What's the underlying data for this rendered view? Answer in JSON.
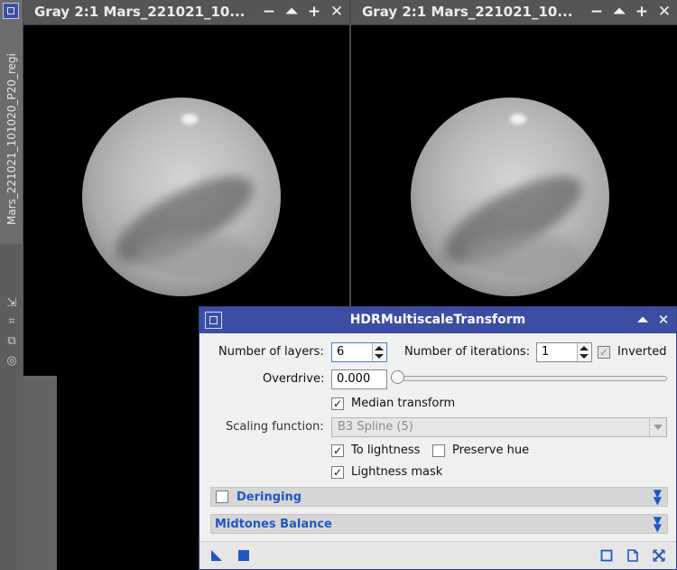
{
  "left_strip": {
    "vertical_tab_label": "Mars_221021_101020_P20_regi",
    "icons": [
      "shrink-icon",
      "fit-icon",
      "clone-icon",
      "target-icon"
    ]
  },
  "windows": [
    {
      "title": "Gray 2:1 Mars_221021_10...",
      "controls": [
        "minimize-icon",
        "shade-icon",
        "maximize-icon",
        "close-icon"
      ]
    },
    {
      "title": "Gray 2:1 Mars_221021_10...",
      "controls": [
        "minimize-icon",
        "shade-icon",
        "maximize-icon",
        "close-icon"
      ]
    }
  ],
  "dialog": {
    "title": "HDRMultiscaleTransform",
    "number_of_layers_label": "Number of layers:",
    "number_of_layers_value": "6",
    "number_of_iterations_label": "Number of iterations:",
    "number_of_iterations_value": "1",
    "inverted_label": "Inverted",
    "inverted_checked": true,
    "overdrive_label": "Overdrive:",
    "overdrive_value": "0.000",
    "overdrive_fraction": 0,
    "median_transform_label": "Median transform",
    "median_transform_checked": true,
    "scaling_function_label": "Scaling function:",
    "scaling_function_value": "B3 Spline (5)",
    "to_lightness_label": "To lightness",
    "to_lightness_checked": true,
    "preserve_hue_label": "Preserve hue",
    "preserve_hue_checked": false,
    "lightness_mask_label": "Lightness mask",
    "lightness_mask_checked": true,
    "sections": {
      "deringing": {
        "title": "Deringing",
        "enabled": false
      },
      "midtones": {
        "title": "Midtones Balance"
      }
    },
    "accent_color": "#3c4ea3",
    "section_title_color": "#1f57c3"
  }
}
